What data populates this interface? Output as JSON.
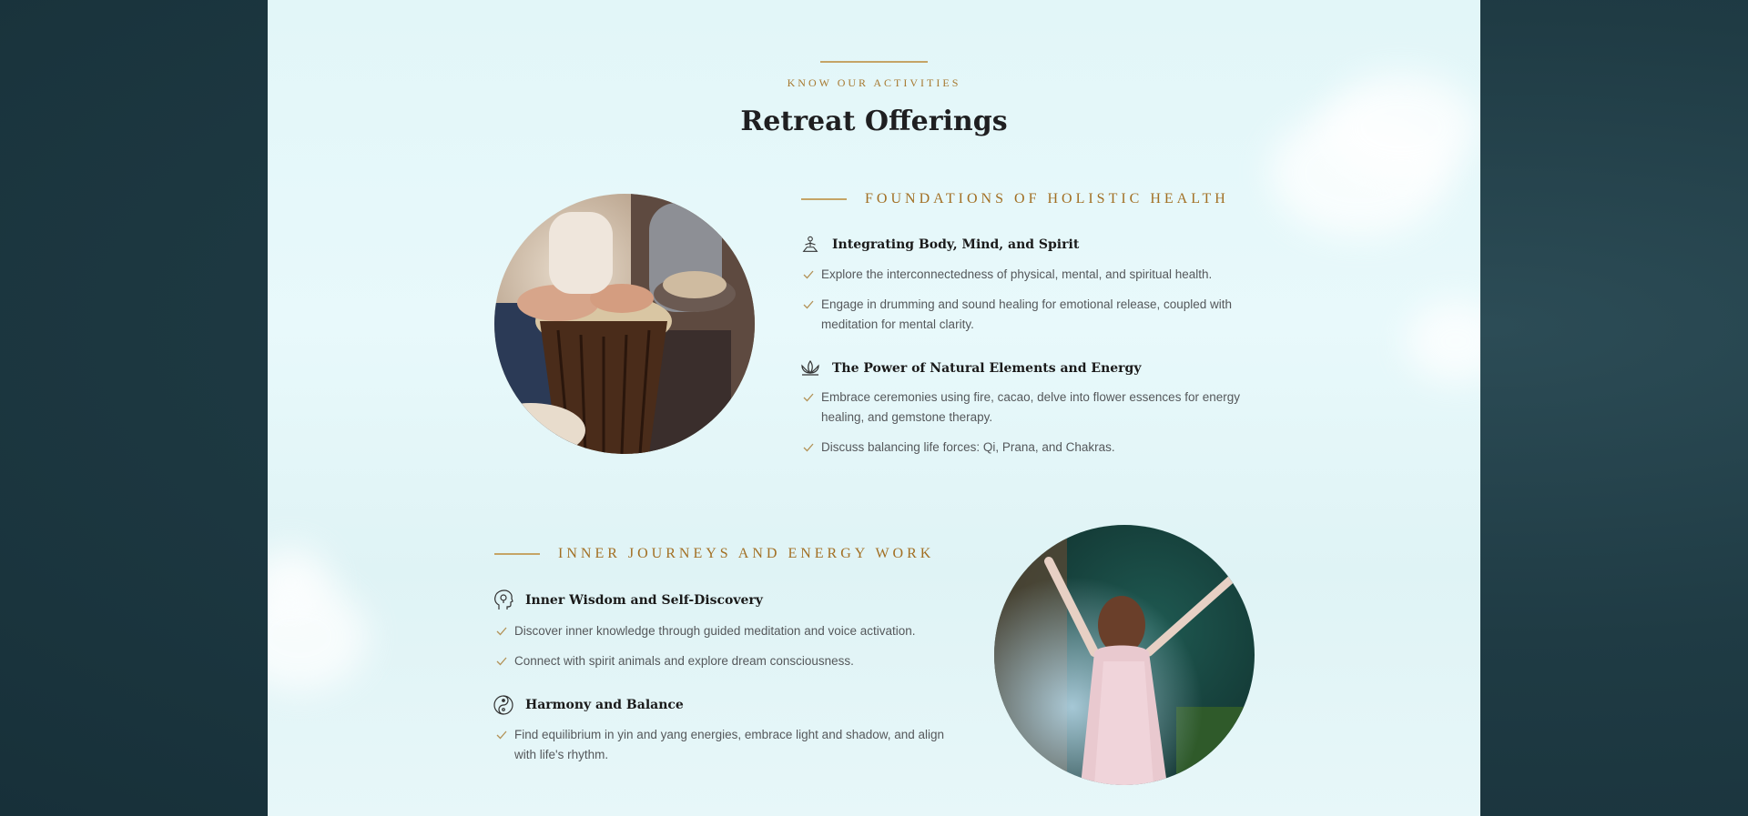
{
  "colors": {
    "accent": "#a26f23",
    "rule": "#c5a466",
    "heading": "#1f1f21",
    "body": "#55585b",
    "outer_bg": "#1f3b44",
    "panel_bg": "#e4f7f9"
  },
  "header": {
    "kicker": "KNOW OUR ACTIVITIES",
    "title": "Retreat Offerings"
  },
  "section1": {
    "title": "FOUNDATIONS OF HOLISTIC HEALTH",
    "image": "hands-playing-djembe-drums",
    "groups": [
      {
        "icon": "meditation-icon",
        "title": "Integrating Body, Mind, and Spirit",
        "items": [
          "Explore the interconnectedness of physical, mental, and spiritual health.",
          "Engage in drumming and sound healing for emotional release, coupled with meditation for mental clarity."
        ]
      },
      {
        "icon": "lotus-icon",
        "title": "The Power of Natural Elements and Energy",
        "items": [
          "Embrace ceremonies using fire, cacao, delve into flower essences for energy healing, and gemstone therapy.",
          "Discuss balancing life forces: Qi, Prana, and Chakras."
        ]
      }
    ]
  },
  "section2": {
    "title": "INNER JOURNEYS AND ENERGY WORK",
    "image": "woman-with-raised-arms-in-forest",
    "groups": [
      {
        "icon": "mind-head-icon",
        "title": "Inner Wisdom and Self-Discovery",
        "items": [
          "Discover inner knowledge through guided meditation and voice activation.",
          "Connect with spirit animals and explore dream consciousness."
        ]
      },
      {
        "icon": "yin-yang-icon",
        "title": "Harmony and Balance",
        "items": [
          "Find equilibrium in yin and yang energies, embrace light and shadow, and align with life's rhythm."
        ]
      }
    ]
  }
}
